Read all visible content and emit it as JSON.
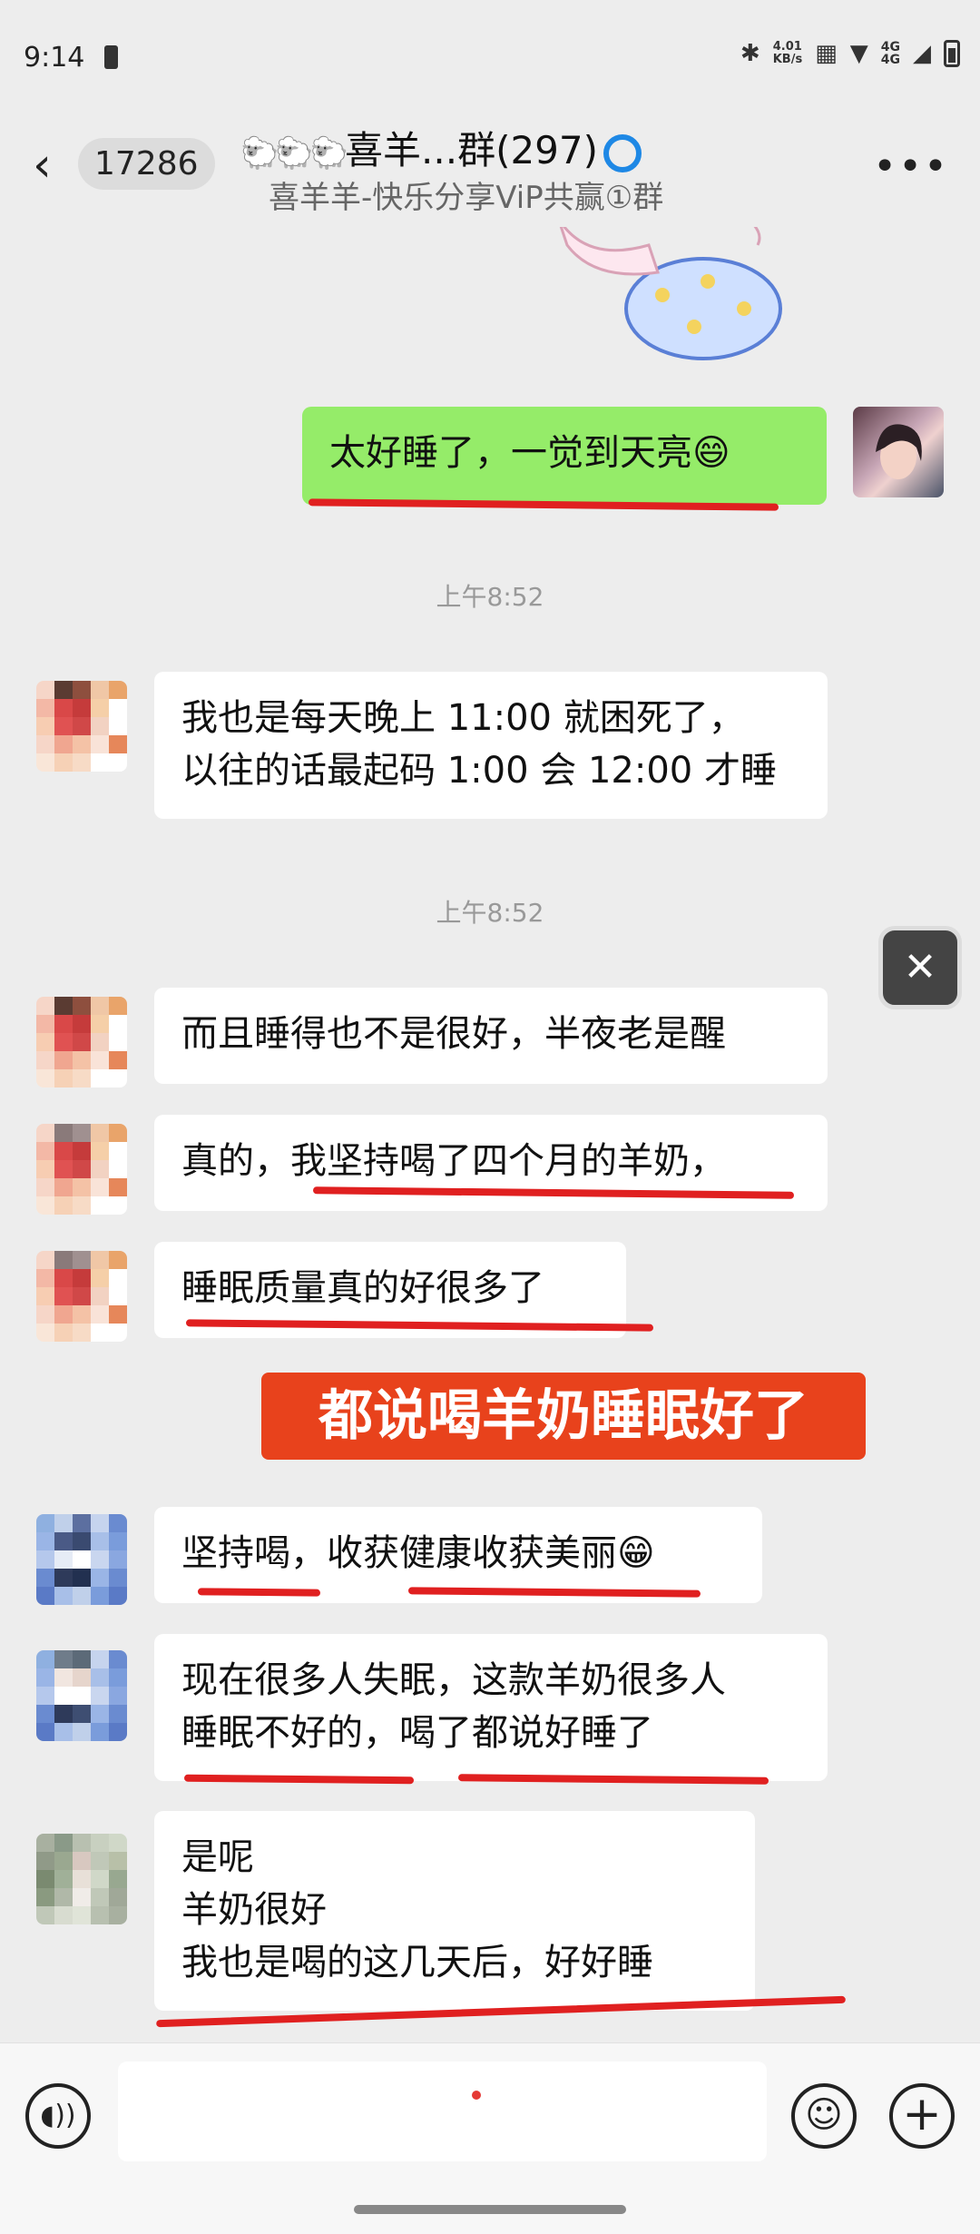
{
  "status": {
    "time": "9:14",
    "net_speed_value": "4.01",
    "net_speed_unit": "KB/s",
    "network_top": "4G",
    "network_bottom": "4G"
  },
  "header": {
    "back_count": "17286",
    "title_sheep": "🐑🐑🐑",
    "title_text": "喜羊...群(297)",
    "subtitle": "喜羊羊-快乐分享ViP共赢①群"
  },
  "messages": [
    {
      "id": "m1",
      "text": "太好睡了，一觉到天亮😄",
      "mine": true
    },
    {
      "id": "t1",
      "timestamp": "上午8:52"
    },
    {
      "id": "m2",
      "lines": [
        "我也是每天晚上 11:00 就困死了，",
        "以往的话最起码 1:00 会 12:00 才睡"
      ]
    },
    {
      "id": "t2",
      "timestamp": "上午8:52"
    },
    {
      "id": "m3",
      "text": "而且睡得也不是很好，半夜老是醒"
    },
    {
      "id": "m4",
      "text": "真的，我坚持喝了四个月的羊奶，"
    },
    {
      "id": "m5",
      "text": "睡眠质量真的好很多了"
    },
    {
      "id": "m6",
      "text": "坚持喝，收获健康收获美丽😁"
    },
    {
      "id": "m7",
      "lines": [
        "现在很多人失眠，这款羊奶很多人",
        "睡眠不好的，喝了都说好睡了"
      ]
    },
    {
      "id": "m8",
      "lines": [
        "是呢",
        "羊奶很好",
        "我也是喝的这几天后，好好睡"
      ]
    }
  ],
  "banner": "都说喝羊奶睡眠好了",
  "colors": {
    "accent_red": "#e02020",
    "my_bubble": "#95ec69",
    "banner_bg": "#e8421c"
  },
  "icons": {
    "back": "chevron-left-icon",
    "more": "more-dots-icon",
    "voice": "voice-icon",
    "emoji": "emoji-icon",
    "plus": "plus-icon",
    "capcut": "capcut-icon"
  }
}
